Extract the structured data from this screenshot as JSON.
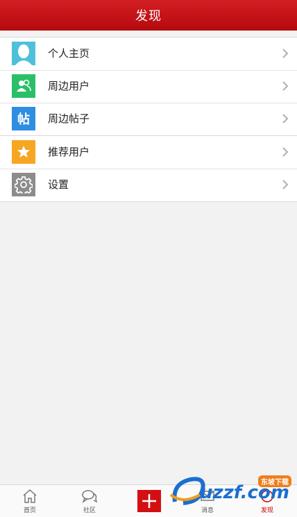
{
  "header": {
    "title": "发现"
  },
  "menu_group_1": [
    {
      "label": "个人主页",
      "icon": "avatar-icon",
      "color": "#4ec0d9"
    },
    {
      "label": "周边用户",
      "icon": "users-icon",
      "color": "#2bbf6a"
    },
    {
      "label": "周边帖子",
      "icon": "post-icon",
      "icon_text": "帖",
      "color": "#2e8fe0"
    }
  ],
  "menu_group_2": [
    {
      "label": "推荐用户",
      "icon": "star-icon",
      "color": "#f5a623"
    },
    {
      "label": "设置",
      "icon": "gear-icon",
      "color": "#8c8c8c"
    }
  ],
  "tabbar": {
    "items": [
      {
        "label": "首页",
        "icon": "home-icon"
      },
      {
        "label": "社区",
        "icon": "chat-icon"
      },
      {
        "label": "",
        "icon": "plus-icon"
      },
      {
        "label": "消息",
        "icon": "message-icon"
      },
      {
        "label": "发现",
        "icon": "discover-icon",
        "active": true
      }
    ]
  },
  "watermark": {
    "text": "uzzf.com",
    "badge": "东坡下载"
  },
  "colors": {
    "header": "#c3141a",
    "active_tab": "#cc0000",
    "plus_button": "#d40f12"
  }
}
